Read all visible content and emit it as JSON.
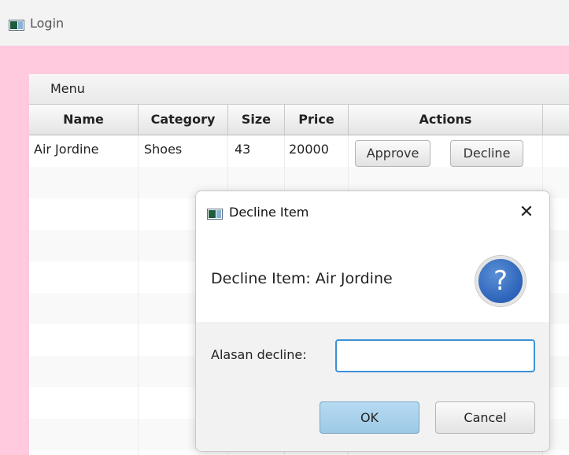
{
  "window": {
    "title": "Login"
  },
  "menubar": {
    "menu_label": "Menu"
  },
  "table": {
    "columns": [
      "Name",
      "Category",
      "Size",
      "Price",
      "Actions"
    ],
    "rows": [
      {
        "name": "Air Jordine",
        "category": "Shoes",
        "size": "43",
        "price": "20000",
        "approve_label": "Approve",
        "decline_label": "Decline"
      }
    ]
  },
  "dialog": {
    "title": "Decline Item",
    "header_text": "Decline Item: Air Jordine",
    "reason_label": "Alasan decline:",
    "reason_value": "",
    "ok_label": "OK",
    "cancel_label": "Cancel",
    "icon_glyph": "?"
  },
  "colors": {
    "background_accent": "#ffc9de",
    "default_button": "#9dc9e6",
    "focus_border": "#3c92d6",
    "question_icon": "#2c63b8"
  }
}
